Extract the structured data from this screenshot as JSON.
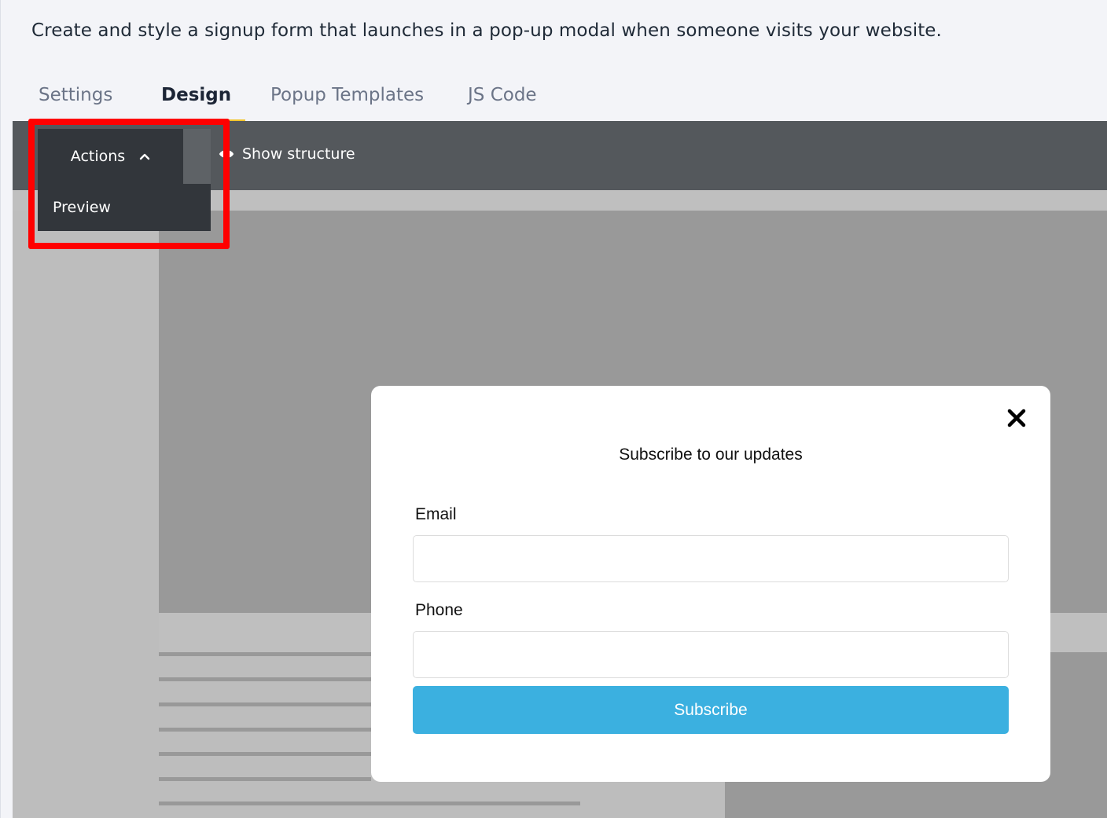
{
  "header": {
    "description": "Create and style a signup form that launches in a pop-up modal when someone visits your website."
  },
  "tabs": [
    {
      "label": "Settings",
      "active": false
    },
    {
      "label": "Design",
      "active": true
    },
    {
      "label": "Popup Templates",
      "active": false
    },
    {
      "label": "JS Code",
      "active": false
    }
  ],
  "toolbar": {
    "actions_label": "Actions",
    "actions_icon": "chevron-up-icon",
    "show_structure_label": "Show structure",
    "show_structure_icon": "eye-icon"
  },
  "actions_menu": {
    "items": [
      {
        "label": "Preview"
      }
    ]
  },
  "modal": {
    "title": "Subscribe to our updates",
    "close_icon": "close-icon",
    "fields": [
      {
        "label": "Email",
        "value": "",
        "placeholder": ""
      },
      {
        "label": "Phone",
        "value": "",
        "placeholder": ""
      }
    ],
    "submit_label": "Subscribe"
  },
  "colors": {
    "tab_active_underline": "#f2c52c",
    "toolbar_bg": "#54585c",
    "dropdown_bg": "#32363b",
    "highlight": "#ff0000",
    "subscribe_button": "#3bb0e0"
  }
}
